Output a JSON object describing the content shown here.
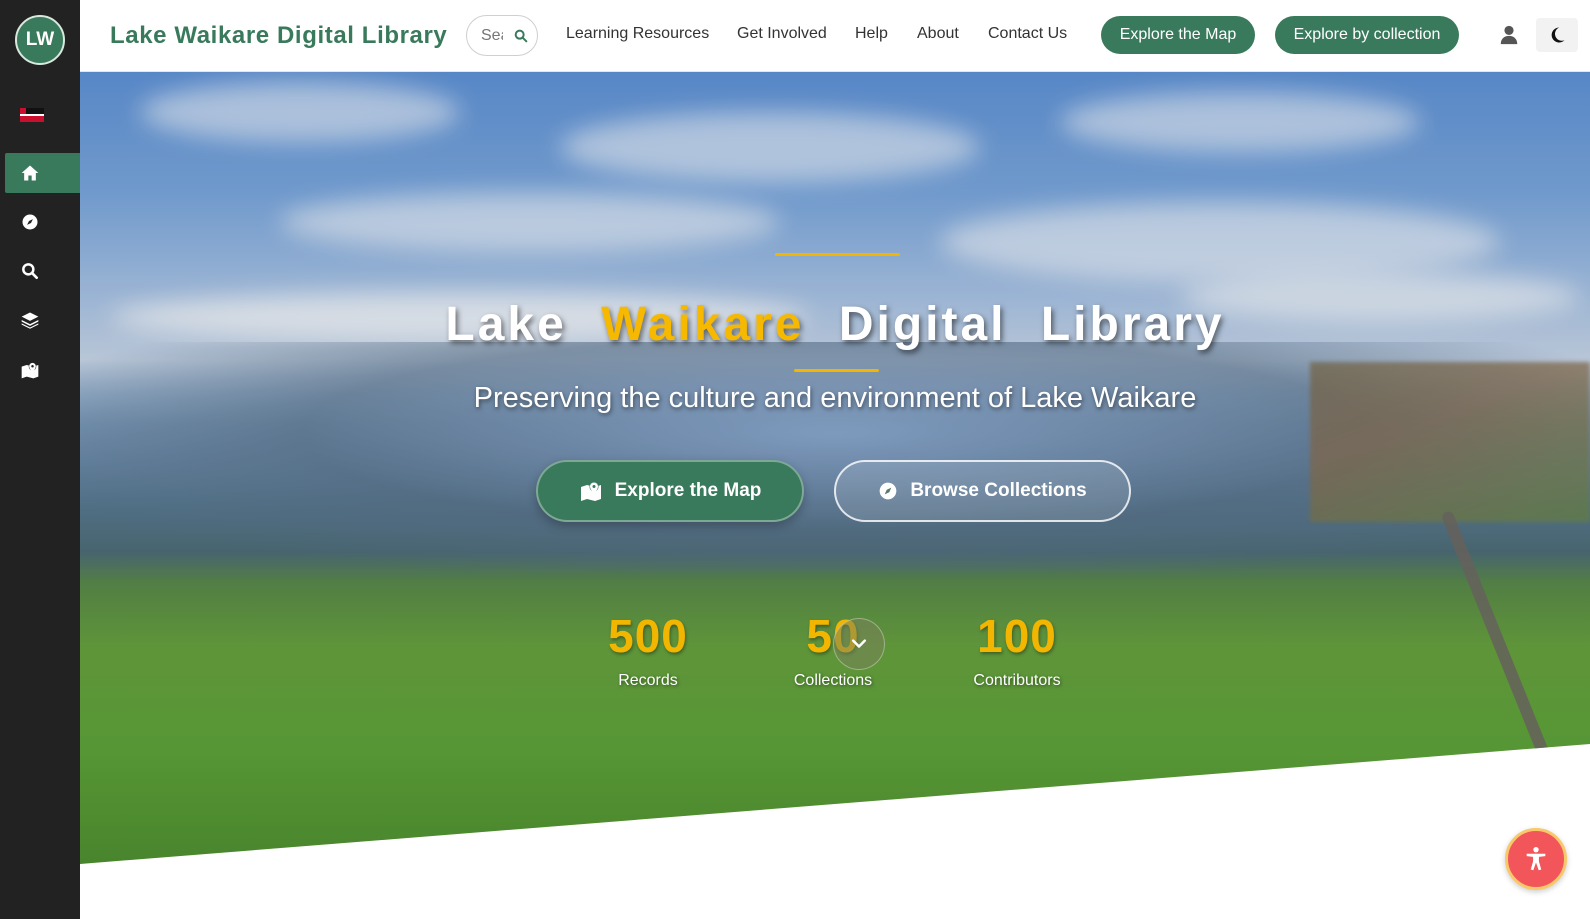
{
  "sidebar": {
    "logo": "LW",
    "items": [
      {
        "icon": "home-icon",
        "active": true
      },
      {
        "icon": "compass-icon",
        "active": false
      },
      {
        "icon": "search-icon",
        "active": false
      },
      {
        "icon": "layers-icon",
        "active": false
      },
      {
        "icon": "map-marker-icon",
        "active": false
      }
    ]
  },
  "header": {
    "brand": "Lake Waikare Digital Library",
    "search_placeholder": "Search",
    "nav": [
      "Learning Resources",
      "Get Involved",
      "Help",
      "About",
      "Contact Us"
    ],
    "cta_map": "Explore the Map",
    "cta_collection": "Explore by collection"
  },
  "hero": {
    "title_part1": "Lake",
    "title_highlight": "Waikare",
    "title_part2": "Digital",
    "title_part3": "Library",
    "subtitle": "Preserving the culture and environment of Lake Waikare",
    "btn_map": "Explore the Map",
    "btn_browse": "Browse Collections",
    "stats": [
      {
        "value": "500",
        "label": "Records"
      },
      {
        "value": "50",
        "label": "Collections"
      },
      {
        "value": "100",
        "label": "Contributors"
      }
    ]
  },
  "colors": {
    "brand_green": "#3a7a5c",
    "accent_gold": "#f2b600",
    "sidebar_bg": "#222222",
    "a11y_red": "#f2565a"
  }
}
